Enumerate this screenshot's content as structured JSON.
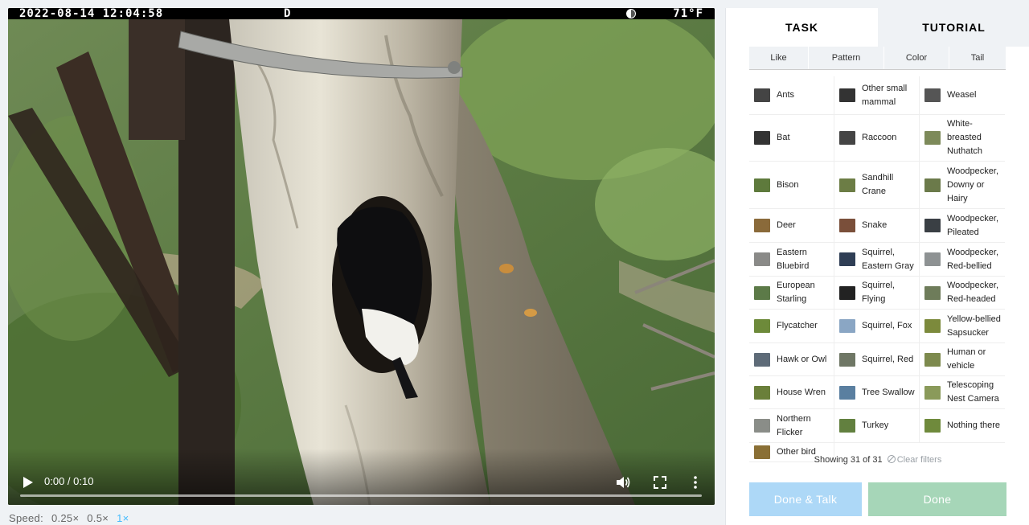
{
  "video": {
    "osd": {
      "timestamp": "2022-08-14 12:04:58",
      "mode": "D",
      "temperature": "71°F"
    },
    "time": "0:00 / 0:10",
    "progress": 0.0,
    "icons": [
      "play-icon",
      "volume-icon",
      "fullscreen-icon",
      "more-vert-icon",
      "moon-phase-icon"
    ]
  },
  "speed": {
    "label": "Speed:",
    "options": [
      "0.25×",
      "0.5×",
      "1×"
    ],
    "active": "1×"
  },
  "panel": {
    "tabs": {
      "task": "TASK",
      "tutorial": "TUTORIAL"
    },
    "filters": [
      "Like",
      "Pattern",
      "Color",
      "Tail"
    ],
    "species": [
      [
        "Ants",
        "Other small mammal",
        "Weasel"
      ],
      [
        "Bat",
        "Raccoon",
        "White-breasted Nuthatch"
      ],
      [
        "Bison",
        "Sandhill Crane",
        "Woodpecker, Downy or Hairy"
      ],
      [
        "Deer",
        "Snake",
        "Woodpecker, Pileated"
      ],
      [
        "Eastern Bluebird",
        "Squirrel, Eastern Gray",
        "Woodpecker, Red-bellied"
      ],
      [
        "European Starling",
        "Squirrel, Flying",
        "Woodpecker, Red-headed"
      ],
      [
        "Flycatcher",
        "Squirrel, Fox",
        "Yellow-bellied Sapsucker"
      ],
      [
        "Hawk or Owl",
        "Squirrel, Red",
        "Human or vehicle"
      ],
      [
        "House Wren",
        "Tree Swallow",
        "Telescoping Nest Camera"
      ],
      [
        "Northern Flicker",
        "Turkey",
        "Nothing there"
      ],
      [
        "Other bird"
      ]
    ],
    "showing": "Showing 31 of 31",
    "clear_filters": "Clear filters",
    "buttons": {
      "done_talk": "Done & Talk",
      "done": "Done"
    }
  },
  "colors": {
    "accent_speed": "#43bbfd",
    "done_talk_bg": "#add8f7",
    "done_bg": "#a6d6b8",
    "tab_inactive_bg": "#eff2f5"
  }
}
